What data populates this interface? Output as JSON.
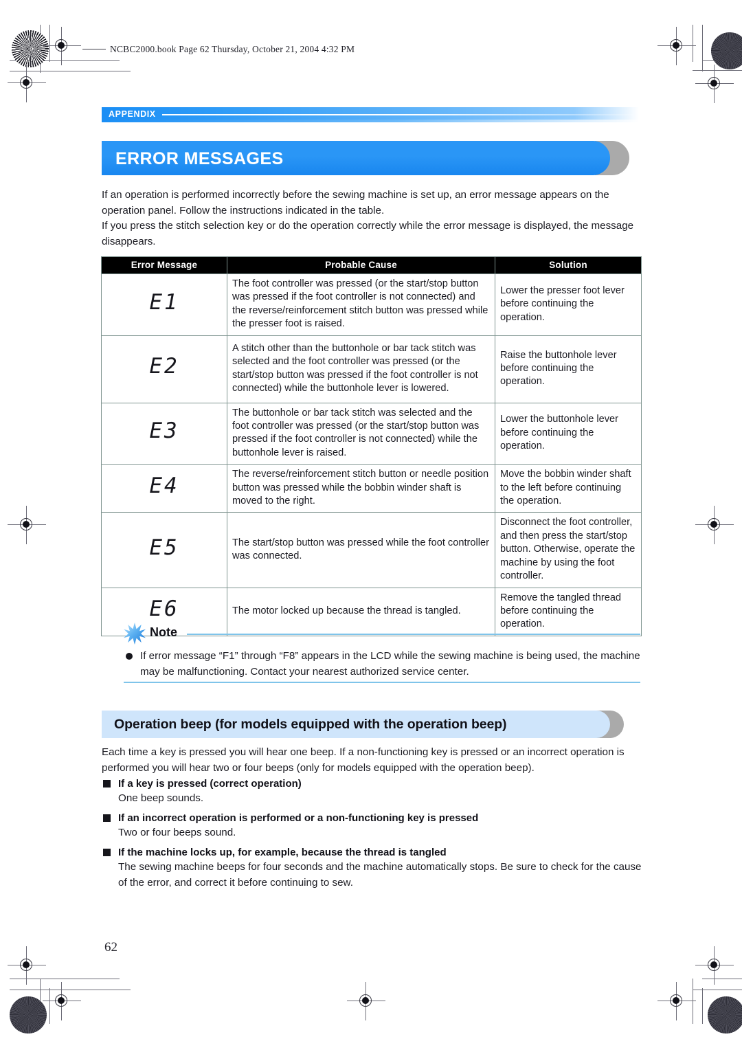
{
  "file_header": "NCBC2000.book  Page 62  Thursday, October 21, 2004  4:32 PM",
  "running_head": "APPENDIX",
  "title": "ERROR MESSAGES",
  "intro": "If an operation is performed incorrectly before the sewing machine is set up, an error message appears on the operation panel. Follow the instructions indicated in the table.\nIf you press the stitch selection key or do the operation correctly while the error message is displayed, the message disappears.",
  "table": {
    "headers": [
      "Error Message",
      "Probable Cause",
      "Solution"
    ],
    "rows": [
      {
        "code": "E1",
        "cause": "The foot controller was pressed (or the start/stop button was pressed if the foot controller is not connected) and the reverse/reinforcement stitch button was pressed while the presser foot is raised.",
        "solution": "Lower the presser foot lever before continuing the operation."
      },
      {
        "code": "E2",
        "cause": "A stitch other than the buttonhole or bar tack stitch was selected and the foot controller was pressed (or the start/stop button was pressed if the foot controller is not connected) while the buttonhole lever is lowered.",
        "solution": "Raise the buttonhole lever before continuing the operation."
      },
      {
        "code": "E3",
        "cause": "The buttonhole or bar tack stitch was selected and the foot controller was pressed (or the start/stop button was pressed if the foot controller is not connected) while the buttonhole lever is raised.",
        "solution": "Lower the buttonhole lever before continuing the operation."
      },
      {
        "code": "E4",
        "cause": "The reverse/reinforcement stitch button or needle position button was pressed while the bobbin winder shaft is moved to the right.",
        "solution": "Move the bobbin winder shaft to the left before continuing the operation."
      },
      {
        "code": "E5",
        "cause": "The start/stop button was pressed while the foot controller was connected.",
        "solution": "Disconnect the foot controller, and then press the start/stop button. Otherwise, operate the machine by using the foot controller."
      },
      {
        "code": "E6",
        "cause": "The motor locked up because the thread is tangled.",
        "solution": "Remove the tangled thread before continuing the operation."
      }
    ]
  },
  "note": {
    "title": "Note",
    "body": "If error message “F1” through “F8” appears in the LCD while the sewing machine is being used, the machine may be malfunctioning. Contact your nearest authorized service center."
  },
  "section2": {
    "title": "Operation beep (for models equipped with the operation beep)",
    "intro": "Each time a key is pressed you will hear one beep. If a non-functioning key is pressed or an incorrect operation is performed you will hear two or four beeps (only for models equipped with the operation beep).",
    "items": [
      {
        "heading": "If a key is pressed (correct operation)",
        "text": "One beep sounds."
      },
      {
        "heading": "If an incorrect operation is performed or a non-functioning key is pressed",
        "text": "Two or four beeps sound."
      },
      {
        "heading": "If the machine locks up, for example, because the thread is tangled",
        "text": "The sewing machine beeps for four seconds and the machine automatically stops. Be sure to check for the cause of the error, and correct it before continuing to sew."
      }
    ]
  },
  "page_number": "62",
  "colors": {
    "banner_blue": "#2a96f6",
    "sub_banner_blue": "#cfe5fb",
    "note_rule": "#7fc4ea",
    "table_border": "#7f9490",
    "shadow_gray": "#aaaaaa"
  }
}
